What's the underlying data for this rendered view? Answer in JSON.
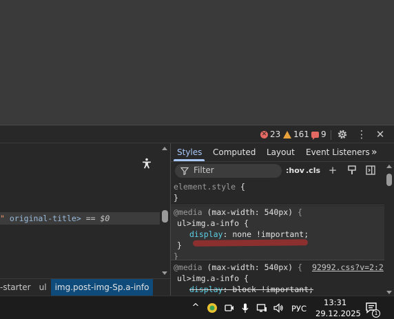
{
  "devtools": {
    "counters": {
      "errors": "23",
      "warnings": "161",
      "issues": "9"
    },
    "colors": {
      "error": "#e46962",
      "warning": "#e8a23b",
      "accent": "#a8c7fa",
      "selection": "#0e4a7a"
    }
  },
  "elements": {
    "selected_line": {
      "quote": "\"",
      "attr": "original-title",
      "close": ">",
      "eq": "==",
      "var": "$0"
    },
    "breadcrumb": [
      "-starter",
      "ul",
      "img.post-img-Sp.a-info"
    ]
  },
  "styles": {
    "tabs": [
      "Styles",
      "Computed",
      "Layout",
      "Event Listeners"
    ],
    "filter_placeholder": "Filter",
    "hov": ":hov",
    "cls": ".cls",
    "element_style": {
      "selector": "element.style",
      "open": "{",
      "close": "}"
    },
    "rule1": {
      "media_kw": "@media",
      "media_q": "(max-width: 540px)",
      "media_open": "{",
      "selector": "ul>img.a-info",
      "open": "{",
      "prop": "display",
      "colon": ":",
      "value": "none !important;",
      "close": "}",
      "media_close": "}"
    },
    "rule2": {
      "media_kw": "@media",
      "media_q": "(max-width: 540px)",
      "media_open": "{",
      "source": "92992.css?v=2:2",
      "selector": "ul>img.a-info",
      "open": "{",
      "prop": "display",
      "colon": ":",
      "value": "block !important;"
    }
  },
  "taskbar": {
    "language": "РУС",
    "time": "13:31",
    "date": "29.12.2025",
    "notifications": "1"
  }
}
